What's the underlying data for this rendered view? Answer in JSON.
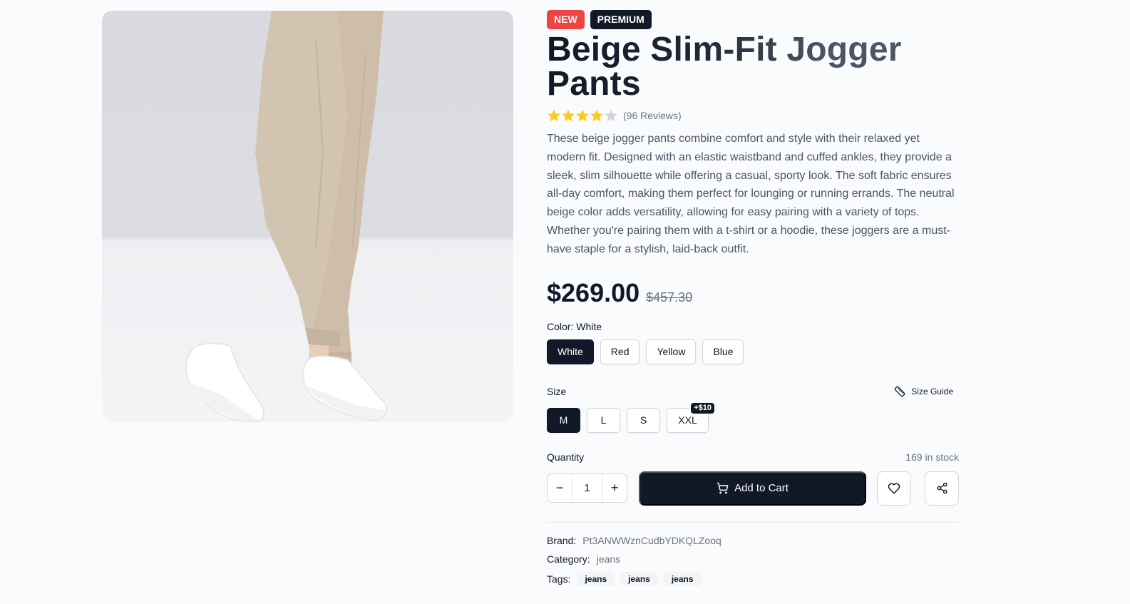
{
  "product": {
    "image_alt": "Beige jogger pants with white sneakers",
    "badges": {
      "new": "NEW",
      "premium": "PREMIUM"
    },
    "title": "Beige Slim-Fit Jogger Pants",
    "rating": {
      "stars": 4,
      "max": 5,
      "reviews_text": "(96 Reviews)"
    },
    "description": "These beige jogger pants combine comfort and style with their relaxed yet modern fit. Designed with an elastic waistband and cuffed ankles, they provide a sleek, slim silhouette while offering a casual, sporty look. The soft fabric ensures all-day comfort, making them perfect for lounging or running errands. The neutral beige color adds versatility, allowing for easy pairing with a variety of tops. Whether you're pairing them with a t-shirt or a hoodie, these joggers are a must-have staple for a stylish, laid-back outfit.",
    "price": "$269.00",
    "old_price": "$457.30"
  },
  "color": {
    "label": "Color: White",
    "options": [
      "White",
      "Red",
      "Yellow",
      "Blue"
    ],
    "selected": "White"
  },
  "size": {
    "label": "Size",
    "guide_label": "Size Guide",
    "options": [
      "M",
      "L",
      "S",
      "XXL"
    ],
    "selected": "M",
    "xxl_extra": "+$10"
  },
  "quantity": {
    "label": "Quantity",
    "value": "1",
    "stock_text": "169 in stock",
    "minus": "−",
    "plus": "+"
  },
  "actions": {
    "add_to_cart": "Add to Cart"
  },
  "meta": {
    "brand_key": "Brand:",
    "brand_val": "Pt3ANWWznCudbYDKQLZooq",
    "category_key": "Category:",
    "category_val": "jeans",
    "tags_key": "Tags:",
    "tags": [
      "jeans",
      "jeans",
      "jeans"
    ]
  },
  "colors": {
    "primary": "#111827",
    "new_badge": "#ef4444",
    "star": "#facc15",
    "star_empty": "#d1d5db"
  },
  "icons": {
    "wishlist": "heart-icon",
    "share": "share-icon",
    "cart": "cart-icon",
    "size_guide": "ruler-icon"
  }
}
